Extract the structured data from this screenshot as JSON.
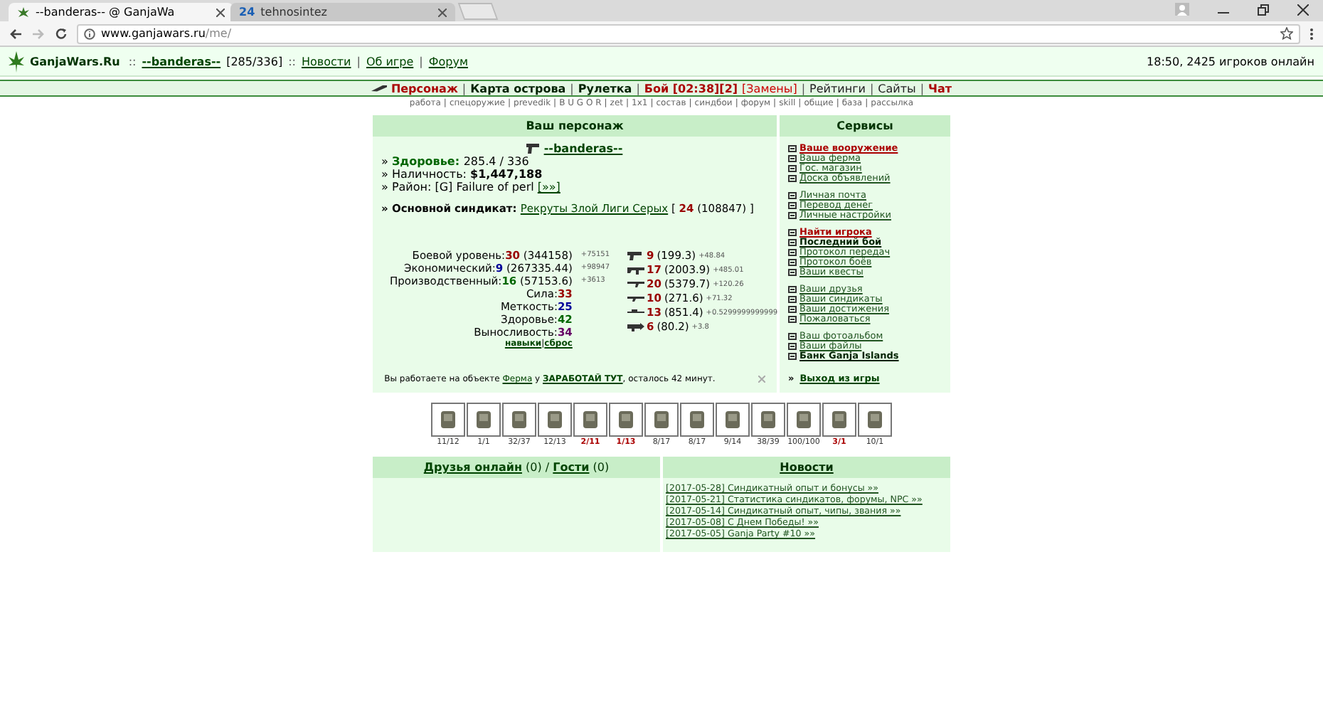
{
  "browser": {
    "tabs": [
      {
        "title": "--banderas-- @ GanjaWa",
        "selected": true
      },
      {
        "title": "tehnosintez",
        "badge": "24",
        "selected": false
      }
    ],
    "address": {
      "host": "www.ganjawars.ru",
      "path": "/me/"
    }
  },
  "header": {
    "logo": "GanjaWars.Ru",
    "items": [
      {
        "kind": "sep",
        "text": "::"
      },
      {
        "kind": "player",
        "text": "--banderas--"
      },
      {
        "kind": "text",
        "text": "[285/336]"
      },
      {
        "kind": "sep",
        "text": "::"
      },
      {
        "kind": "link",
        "text": "Новости"
      },
      {
        "kind": "sep",
        "text": "|"
      },
      {
        "kind": "link",
        "text": "Об игре"
      },
      {
        "kind": "sep",
        "text": "|"
      },
      {
        "kind": "link",
        "text": "Форум"
      }
    ],
    "status": "18:50, 2425 игроков онлайн"
  },
  "nav": [
    {
      "kind": "alert",
      "text": "Персонаж"
    },
    {
      "kind": "sep",
      "text": "|"
    },
    {
      "kind": "main",
      "text": "Карта острова"
    },
    {
      "kind": "sep",
      "text": "|"
    },
    {
      "kind": "main",
      "text": "Рулетка"
    },
    {
      "kind": "sep",
      "text": "|"
    },
    {
      "kind": "alert",
      "text": "Бой [02:38][2]"
    },
    {
      "kind": "notice",
      "text": "[Замены]"
    },
    {
      "kind": "sep",
      "text": "|"
    },
    {
      "kind": "plain",
      "text": "Рейтинги"
    },
    {
      "kind": "sep",
      "text": "|"
    },
    {
      "kind": "plain",
      "text": "Сайты"
    },
    {
      "kind": "sep",
      "text": "|"
    },
    {
      "kind": "alert",
      "text": "Чат"
    }
  ],
  "subnav": [
    {
      "kind": "link",
      "text": "работа"
    },
    {
      "kind": "sep",
      "text": "|"
    },
    {
      "kind": "link",
      "text": "спецоружие"
    },
    {
      "kind": "sep",
      "text": "|"
    },
    {
      "kind": "link",
      "text": "prevedik"
    },
    {
      "kind": "sep",
      "text": "|"
    },
    {
      "kind": "link",
      "text": "B U G O R"
    },
    {
      "kind": "sep",
      "text": "|"
    },
    {
      "kind": "link",
      "text": "zet"
    },
    {
      "kind": "sep",
      "text": "|"
    },
    {
      "kind": "link",
      "text": "1x1"
    },
    {
      "kind": "sep",
      "text": "|"
    },
    {
      "kind": "link",
      "text": "состав"
    },
    {
      "kind": "sep",
      "text": "|"
    },
    {
      "kind": "link",
      "text": "синдбои"
    },
    {
      "kind": "sep",
      "text": "|"
    },
    {
      "kind": "link",
      "text": "форум"
    },
    {
      "kind": "sep",
      "text": "|"
    },
    {
      "kind": "link",
      "text": "skill"
    },
    {
      "kind": "sep",
      "text": "|"
    },
    {
      "kind": "link",
      "text": "общие"
    },
    {
      "kind": "sep",
      "text": "|"
    },
    {
      "kind": "link",
      "text": "база"
    },
    {
      "kind": "sep",
      "text": "|"
    },
    {
      "kind": "link",
      "text": "рассылка"
    }
  ],
  "character": {
    "title": "Ваш персонаж",
    "name": "--banderas--",
    "facts": [
      {
        "kind": "health",
        "marker": "»",
        "label": "Здоровье:",
        "value": "285.4 / 336"
      },
      {
        "kind": "money",
        "marker": "»",
        "label": "Наличность:",
        "value": "$1,447,188"
      },
      {
        "kind": "district",
        "marker": "»",
        "label": "Район:",
        "value": "[G] Failure of perl",
        "link": "[»»]"
      }
    ],
    "syndicate": {
      "marker": "»",
      "label": "Основной синдикат:",
      "name": "Рекруты Злой Лиги Серых",
      "open": "[",
      "level": "24",
      "points": "(108847)",
      "close": "]"
    },
    "levels": [
      {
        "label": "Боевой уровень:",
        "value": "30",
        "points": "(344158)",
        "gain": "+75151",
        "color": "#990000"
      },
      {
        "label": "Экономический:",
        "value": "9",
        "points": "(267335.44)",
        "gain": "+98947",
        "color": "#000099"
      },
      {
        "label": "Производственный:",
        "value": "16",
        "points": "(57153.6)",
        "gain": "+3613",
        "color": "#006600"
      }
    ],
    "attributes": [
      {
        "label": "Сила:",
        "value": "33",
        "color": "#990000"
      },
      {
        "label": "Меткость:",
        "value": "25",
        "color": "#000099"
      },
      {
        "label": "Здоровье:",
        "value": "42",
        "color": "#006600"
      },
      {
        "label": "Выносливость:",
        "value": "34",
        "color": "#660066"
      }
    ],
    "skill_links": [
      {
        "kind": "link",
        "text": "навыки"
      },
      {
        "kind": "sep",
        "text": "|"
      },
      {
        "kind": "link",
        "text": "сброс"
      }
    ],
    "weapons": [
      {
        "kind": "pistol",
        "level": "9",
        "points": "(199.3)",
        "gain": "+48.84"
      },
      {
        "kind": "smg",
        "level": "17",
        "points": "(2003.9)",
        "gain": "+485.01"
      },
      {
        "kind": "rifle",
        "level": "20",
        "points": "(5379.7)",
        "gain": "+120.26"
      },
      {
        "kind": "shotgun",
        "level": "10",
        "points": "(271.6)",
        "gain": "+71.32"
      },
      {
        "kind": "sniper",
        "level": "13",
        "points": "(851.4)",
        "gain": "+0.5299999999999"
      },
      {
        "kind": "launcher",
        "level": "6",
        "points": "(80.2)",
        "gain": "+3.8"
      }
    ],
    "work": {
      "before": "Вы работаете на объекте",
      "place": "Ферма",
      "middle": "у",
      "employer": "ЗАРАБОТАЙ ТУТ",
      "after": ", осталось 42 минут."
    }
  },
  "services": {
    "title": "Сервисы",
    "groups": [
      [
        {
          "kind": "alert",
          "text": "Ваше вооружение"
        },
        {
          "kind": "plain",
          "text": "Ваша ферма"
        },
        {
          "kind": "plain",
          "text": "Гос. магазин"
        },
        {
          "kind": "plain",
          "text": "Доска объявлений"
        }
      ],
      [
        {
          "kind": "plain",
          "text": "Личная почта"
        },
        {
          "kind": "plain",
          "text": "Перевод денег"
        },
        {
          "kind": "plain",
          "text": "Личные настройки"
        }
      ],
      [
        {
          "kind": "alert",
          "text": "Найти игрока"
        },
        {
          "kind": "bold",
          "text": "Последний бой"
        },
        {
          "kind": "plain",
          "text": "Протокол передач"
        },
        {
          "kind": "plain",
          "text": "Протокол боёв"
        },
        {
          "kind": "plain",
          "text": "Ваши квесты"
        }
      ],
      [
        {
          "kind": "plain",
          "text": "Ваши друзья"
        },
        {
          "kind": "plain",
          "text": "Ваши синдикаты"
        },
        {
          "kind": "plain",
          "text": "Ваши достижения"
        },
        {
          "kind": "plain",
          "text": "Пожаловаться"
        }
      ],
      [
        {
          "kind": "plain",
          "text": "Ваш фотоальбом"
        },
        {
          "kind": "plain",
          "text": "Ваши файлы"
        },
        {
          "kind": "bold",
          "text": "Банк Ganja Islands"
        }
      ]
    ],
    "exit": {
      "marker": "»",
      "text": "Выход из игры"
    }
  },
  "items": [
    {
      "count": "11/12",
      "worn": false
    },
    {
      "count": "1/1",
      "worn": false
    },
    {
      "count": "32/37",
      "worn": false
    },
    {
      "count": "12/13",
      "worn": false
    },
    {
      "count": "2/11",
      "worn": true
    },
    {
      "count": "1/13",
      "worn": true
    },
    {
      "count": "8/17",
      "worn": false
    },
    {
      "count": "8/17",
      "worn": false
    },
    {
      "count": "9/14",
      "worn": false
    },
    {
      "count": "38/39",
      "worn": false
    },
    {
      "count": "100/100",
      "worn": false
    },
    {
      "count": "3/1",
      "worn": true
    },
    {
      "count": "10/1",
      "worn": false
    }
  ],
  "friends": {
    "friends_label": "Друзья онлайн",
    "friends_count": "(0)",
    "sep": "/",
    "guests_label": "Гости",
    "guests_count": "(0)"
  },
  "news": {
    "title": "Новости",
    "items": [
      "[2017-05-28] Синдикатный опыт и бонусы »»",
      "[2017-05-21] Статистика синдикатов, форумы, NPC »»",
      "[2017-05-14] Синдикатный опыт, чипы, звания »»",
      "[2017-05-08] С Днем Победы! »»",
      "[2017-05-05] Ganja Party #10 »»"
    ]
  }
}
